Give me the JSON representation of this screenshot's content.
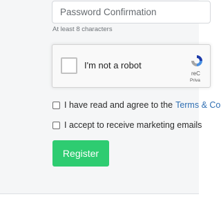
{
  "form": {
    "password_confirmation": {
      "value": "",
      "placeholder": "Password Confirmation",
      "hint": "At least 8 characters"
    },
    "recaptcha": {
      "label": "I'm not a robot",
      "brand": "reC",
      "sub": "Priva"
    },
    "agree_terms": {
      "label": "I have read and agree to the",
      "link": "Terms & Co"
    },
    "marketing": {
      "label": "I accept to receive marketing emails"
    },
    "register_button": {
      "label": "Register"
    }
  },
  "colors": {
    "page_background": "#f5f6f7",
    "register_button": "#2ecc71",
    "link": "#2f6fb3"
  }
}
